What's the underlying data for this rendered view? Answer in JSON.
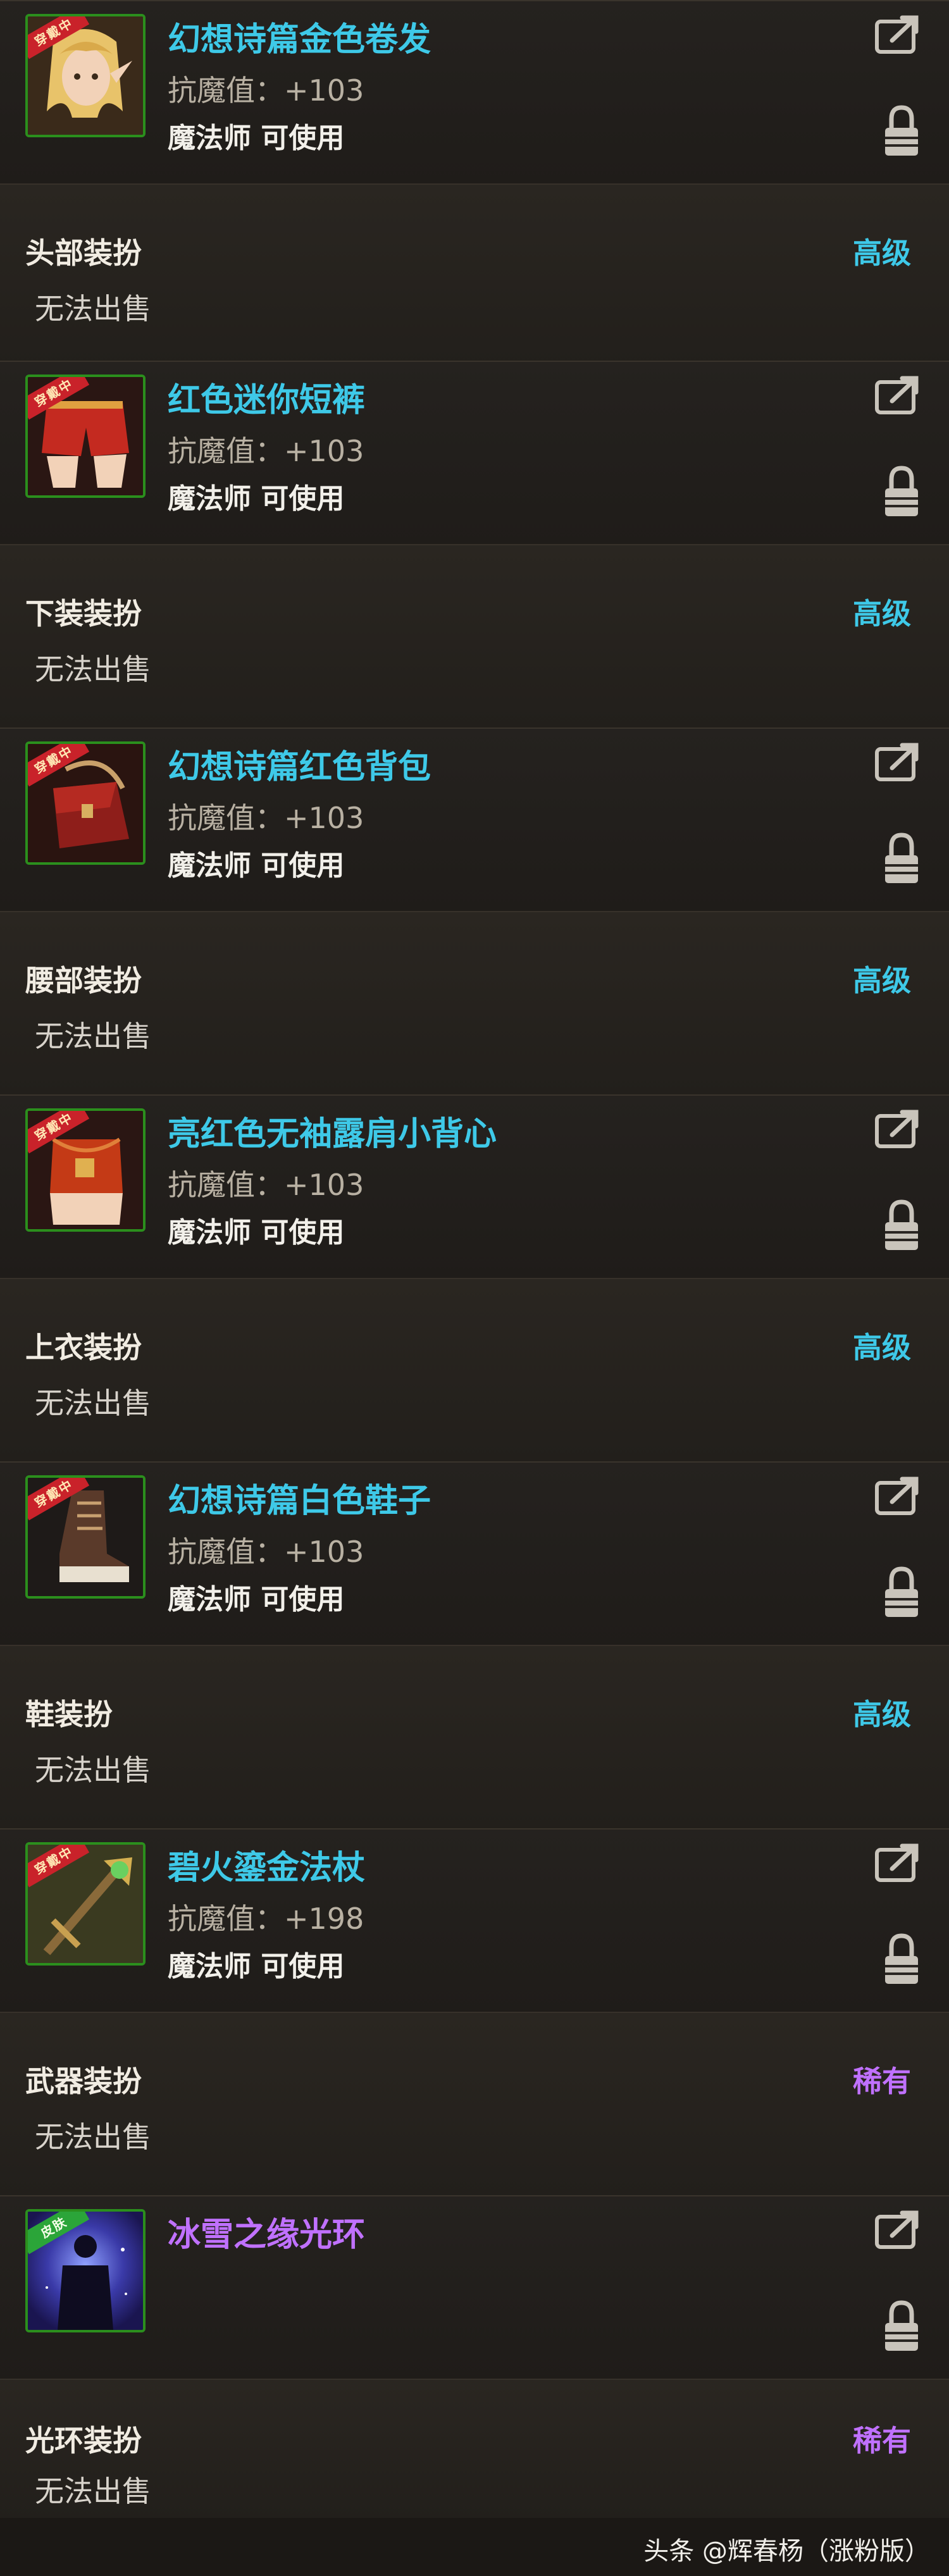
{
  "items": [
    {
      "name": "幻想诗篇金色卷发",
      "name_color": "cyan",
      "badge": "穿戴中",
      "stat": "抗魔值：+103",
      "class_req": "魔法师 可使用",
      "slot": "头部装扮",
      "grade": "高级",
      "grade_color": "cyan",
      "sell": "无法出售",
      "icon": "hair-icon",
      "badge_color": "red"
    },
    {
      "name": "红色迷你短裤",
      "name_color": "cyan",
      "badge": "穿戴中",
      "stat": "抗魔值：+103",
      "class_req": "魔法师 可使用",
      "slot": "下装装扮",
      "grade": "高级",
      "grade_color": "cyan",
      "sell": "无法出售",
      "icon": "shorts-icon",
      "badge_color": "red"
    },
    {
      "name": "幻想诗篇红色背包",
      "name_color": "cyan",
      "badge": "穿戴中",
      "stat": "抗魔值：+103",
      "class_req": "魔法师 可使用",
      "slot": "腰部装扮",
      "grade": "高级",
      "grade_color": "cyan",
      "sell": "无法出售",
      "icon": "bag-icon",
      "badge_color": "red"
    },
    {
      "name": "亮红色无袖露肩小背心",
      "name_color": "cyan",
      "badge": "穿戴中",
      "stat": "抗魔值：+103",
      "class_req": "魔法师 可使用",
      "slot": "上衣装扮",
      "grade": "高级",
      "grade_color": "cyan",
      "sell": "无法出售",
      "icon": "vest-icon",
      "badge_color": "red"
    },
    {
      "name": "幻想诗篇白色鞋子",
      "name_color": "cyan",
      "badge": "穿戴中",
      "stat": "抗魔值：+103",
      "class_req": "魔法师 可使用",
      "slot": "鞋装扮",
      "grade": "高级",
      "grade_color": "cyan",
      "sell": "无法出售",
      "icon": "boot-icon",
      "badge_color": "red"
    },
    {
      "name": "碧火鎏金法杖",
      "name_color": "cyan",
      "badge": "穿戴中",
      "stat": "抗魔值：+198",
      "class_req": "魔法师 可使用",
      "slot": "武器装扮",
      "grade": "稀有",
      "grade_color": "purple",
      "sell": "无法出售",
      "icon": "staff-icon",
      "badge_color": "red"
    },
    {
      "name": "冰雪之缘光环",
      "name_color": "purple",
      "badge": "皮肤",
      "stat": "",
      "class_req": "",
      "slot": "光环装扮",
      "grade": "稀有",
      "grade_color": "purple",
      "sell": "无法出售",
      "icon": "aura-icon",
      "badge_color": "green"
    }
  ],
  "footer": {
    "watermark": "头条 @辉春杨（涨粉版）"
  },
  "colors": {
    "cyan": "#3ec9e8",
    "purple": "#c071ff",
    "badge_red": "#c9222a",
    "badge_green": "#2ba539",
    "frame_green": "#2b8f1d"
  }
}
